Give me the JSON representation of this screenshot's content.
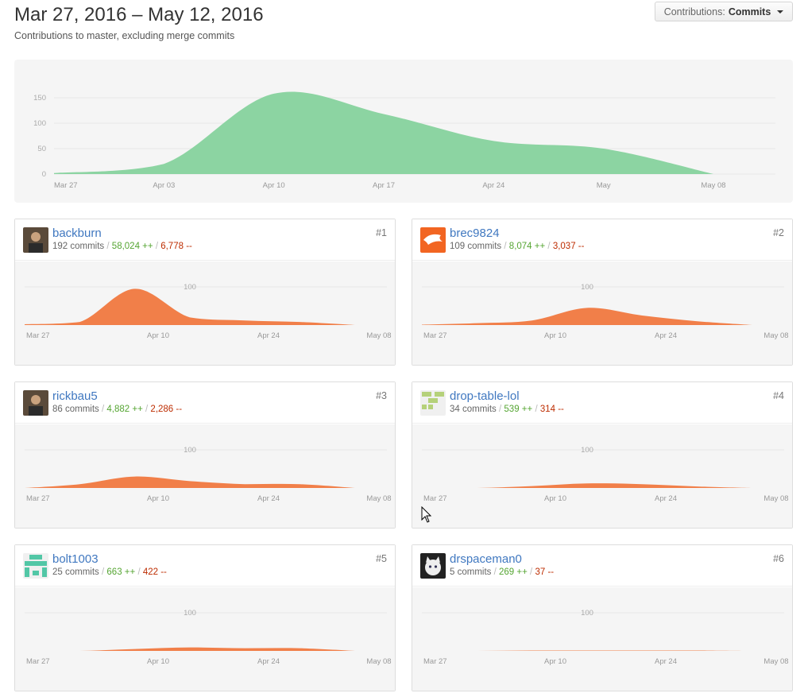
{
  "header": {
    "title": "Mar 27, 2016 – May 12, 2016",
    "subtitle": "Contributions to master, excluding merge commits",
    "dropdown_label": "Contributions:",
    "dropdown_value": "Commits"
  },
  "colors": {
    "main_area": "#8cd4a2",
    "contributor_area": "#f17f49",
    "link": "#4078c0",
    "additions": "#55a532",
    "deletions": "#bd2c00"
  },
  "chart_data": [
    {
      "type": "area",
      "x": [
        "Mar 27",
        "Apr 03",
        "Apr 10",
        "Apr 17",
        "Apr 24",
        "May",
        "May 08"
      ],
      "x_ticks": [
        "Mar 27",
        "Apr 03",
        "Apr 10",
        "Apr 17",
        "Apr 24",
        "May",
        "May 08"
      ],
      "y_ticks": [
        "150",
        "100",
        "50",
        "0"
      ],
      "ylim": [
        0,
        150
      ],
      "values": [
        2,
        20,
        158,
        118,
        65,
        50,
        0
      ],
      "grid": true
    }
  ],
  "contributors": [
    {
      "rank": "#1",
      "name": "backburn",
      "commits": "192 commits",
      "additions": "58,024 ++",
      "deletions": "6,778 --",
      "avatar_icon": "photo-avatar-icon",
      "y_tick": "100",
      "x_ticks": [
        "Mar 27",
        "Apr 10",
        "Apr 24",
        "May 08"
      ],
      "values": [
        2,
        8,
        95,
        20,
        12,
        8,
        0
      ]
    },
    {
      "rank": "#2",
      "name": "brec9824",
      "commits": "109 commits",
      "additions": "8,074 ++",
      "deletions": "3,037 --",
      "avatar_icon": "bronco-logo-icon",
      "y_tick": "100",
      "x_ticks": [
        "Mar 27",
        "Apr 10",
        "Apr 24",
        "May 08"
      ],
      "values": [
        1,
        5,
        12,
        45,
        25,
        10,
        0
      ]
    },
    {
      "rank": "#3",
      "name": "rickbau5",
      "commits": "86 commits",
      "additions": "4,882 ++",
      "deletions": "2,286 --",
      "avatar_icon": "photo-avatar-icon",
      "y_tick": "100",
      "x_ticks": [
        "Mar 27",
        "Apr 10",
        "Apr 24",
        "May 08"
      ],
      "values": [
        0,
        10,
        30,
        18,
        10,
        10,
        0
      ]
    },
    {
      "rank": "#4",
      "name": "drop-table-lol",
      "commits": "34 commits",
      "additions": "539 ++",
      "deletions": "314 --",
      "avatar_icon": "identicon-green-icon",
      "y_tick": "100",
      "x_ticks": [
        "Mar 27",
        "Apr 10",
        "Apr 24",
        "May 08"
      ],
      "values": [
        0,
        0,
        5,
        12,
        10,
        4,
        0
      ]
    },
    {
      "rank": "#5",
      "name": "bolt1003",
      "commits": "25 commits",
      "additions": "663 ++",
      "deletions": "422 --",
      "avatar_icon": "identicon-teal-icon",
      "y_tick": "100",
      "x_ticks": [
        "Mar 27",
        "Apr 10",
        "Apr 24",
        "May 08"
      ],
      "values": [
        0,
        0,
        5,
        9,
        7,
        7,
        0
      ]
    },
    {
      "rank": "#6",
      "name": "drspaceman0",
      "commits": "5 commits",
      "additions": "269 ++",
      "deletions": "37 --",
      "avatar_icon": "cat-photo-icon",
      "y_tick": "100",
      "x_ticks": [
        "Mar 27",
        "Apr 10",
        "Apr 24",
        "May 08"
      ],
      "values": [
        0,
        0,
        1,
        1,
        1,
        1,
        0
      ]
    }
  ]
}
